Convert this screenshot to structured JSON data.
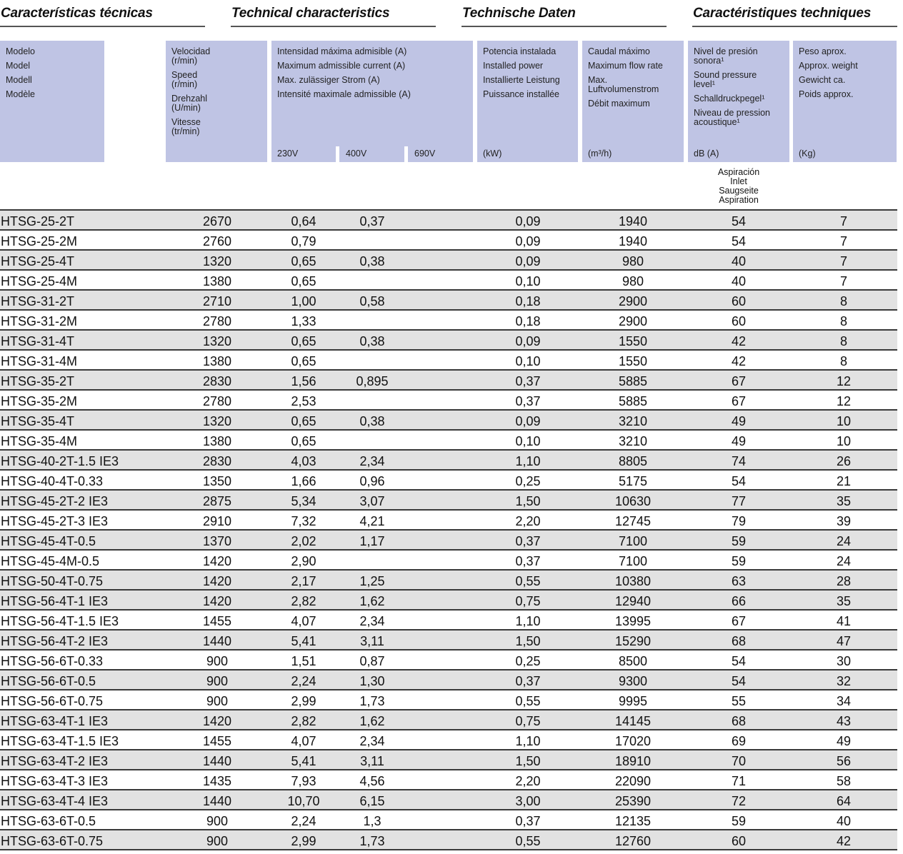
{
  "titles": [
    "Características técnicas",
    "Technical characteristics",
    "Technische Daten",
    "Caractéristiques techniques"
  ],
  "header": {
    "model": [
      "Modelo",
      "Model",
      "Modell",
      "Modèle"
    ],
    "speed": [
      "Velocidad (r/min)",
      "Speed (r/min)",
      "Drehzahl (U/min)",
      "Vitesse (tr/min)"
    ],
    "current": [
      "Intensidad máxima admisible (A)",
      "Maximum admissible current (A)",
      "Max. zulässiger Strom (A)",
      "Intensité maximale admissible (A)"
    ],
    "voltages": [
      "230V",
      "400V",
      "690V"
    ],
    "power": [
      "Potencia instalada",
      "Installed power",
      "Installierte Leistung",
      "Puissance installée"
    ],
    "power_unit": "(kW)",
    "flow": [
      "Caudal máximo",
      "Maximum flow rate",
      "Max. Luftvolumenstrom",
      "Débit maximum"
    ],
    "flow_unit": "(m³/h)",
    "sound": [
      "Nivel de presión sonora¹",
      "Sound pressure level¹",
      "Schalldruckpegel¹",
      "Niveau de pression acoustique¹"
    ],
    "sound_unit": "dB (A)",
    "weight": [
      "Peso aprox.",
      "Approx. weight",
      "Gewicht ca.",
      "Poids approx."
    ],
    "weight_unit": "(Kg)",
    "inlet": [
      "Aspiración",
      "Inlet",
      "Saugseite",
      "Aspiration"
    ]
  },
  "rows": [
    [
      "HTSG-25-2T",
      "2670",
      "0,64",
      "0,37",
      "0,09",
      "1940",
      "54",
      "7"
    ],
    [
      "HTSG-25-2M",
      "2760",
      "0,79",
      "",
      "0,09",
      "1940",
      "54",
      "7"
    ],
    [
      "HTSG-25-4T",
      "1320",
      "0,65",
      "0,38",
      "0,09",
      "980",
      "40",
      "7"
    ],
    [
      "HTSG-25-4M",
      "1380",
      "0,65",
      "",
      "0,10",
      "980",
      "40",
      "7"
    ],
    [
      "HTSG-31-2T",
      "2710",
      "1,00",
      "0,58",
      "0,18",
      "2900",
      "60",
      "8"
    ],
    [
      "HTSG-31-2M",
      "2780",
      "1,33",
      "",
      "0,18",
      "2900",
      "60",
      "8"
    ],
    [
      "HTSG-31-4T",
      "1320",
      "0,65",
      "0,38",
      "0,09",
      "1550",
      "42",
      "8"
    ],
    [
      "HTSG-31-4M",
      "1380",
      "0,65",
      "",
      "0,10",
      "1550",
      "42",
      "8"
    ],
    [
      "HTSG-35-2T",
      "2830",
      "1,56",
      "0,895",
      "0,37",
      "5885",
      "67",
      "12"
    ],
    [
      "HTSG-35-2M",
      "2780",
      "2,53",
      "",
      "0,37",
      "5885",
      "67",
      "12"
    ],
    [
      "HTSG-35-4T",
      "1320",
      "0,65",
      "0,38",
      "0,09",
      "3210",
      "49",
      "10"
    ],
    [
      "HTSG-35-4M",
      "1380",
      "0,65",
      "",
      "0,10",
      "3210",
      "49",
      "10"
    ],
    [
      "HTSG-40-2T-1.5 IE3",
      "2830",
      "4,03",
      "2,34",
      "1,10",
      "8805",
      "74",
      "26"
    ],
    [
      "HTSG-40-4T-0.33",
      "1350",
      "1,66",
      "0,96",
      "0,25",
      "5175",
      "54",
      "21"
    ],
    [
      "HTSG-45-2T-2 IE3",
      "2875",
      "5,34",
      "3,07",
      "1,50",
      "10630",
      "77",
      "35"
    ],
    [
      "HTSG-45-2T-3 IE3",
      "2910",
      "7,32",
      "4,21",
      "2,20",
      "12745",
      "79",
      "39"
    ],
    [
      "HTSG-45-4T-0.5",
      "1370",
      "2,02",
      "1,17",
      "0,37",
      "7100",
      "59",
      "24"
    ],
    [
      "HTSG-45-4M-0.5",
      "1420",
      "2,90",
      "",
      "0,37",
      "7100",
      "59",
      "24"
    ],
    [
      "HTSG-50-4T-0.75",
      "1420",
      "2,17",
      "1,25",
      "0,55",
      "10380",
      "63",
      "28"
    ],
    [
      "HTSG-56-4T-1 IE3",
      "1420",
      "2,82",
      "1,62",
      "0,75",
      "12940",
      "66",
      "35"
    ],
    [
      "HTSG-56-4T-1.5 IE3",
      "1455",
      "4,07",
      "2,34",
      "1,10",
      "13995",
      "67",
      "41"
    ],
    [
      "HTSG-56-4T-2 IE3",
      "1440",
      "5,41",
      "3,11",
      "1,50",
      "15290",
      "68",
      "47"
    ],
    [
      "HTSG-56-6T-0.33",
      "900",
      "1,51",
      "0,87",
      "0,25",
      "8500",
      "54",
      "30"
    ],
    [
      "HTSG-56-6T-0.5",
      "900",
      "2,24",
      "1,30",
      "0,37",
      "9300",
      "54",
      "32"
    ],
    [
      "HTSG-56-6T-0.75",
      "900",
      "2,99",
      "1,73",
      "0,55",
      "9995",
      "55",
      "34"
    ],
    [
      "HTSG-63-4T-1 IE3",
      "1420",
      "2,82",
      "1,62",
      "0,75",
      "14145",
      "68",
      "43"
    ],
    [
      "HTSG-63-4T-1.5 IE3",
      "1455",
      "4,07",
      "2,34",
      "1,10",
      "17020",
      "69",
      "49"
    ],
    [
      "HTSG-63-4T-2 IE3",
      "1440",
      "5,41",
      "3,11",
      "1,50",
      "18910",
      "70",
      "56"
    ],
    [
      "HTSG-63-4T-3 IE3",
      "1435",
      "7,93",
      "4,56",
      "2,20",
      "22090",
      "71",
      "58"
    ],
    [
      "HTSG-63-4T-4 IE3",
      "1440",
      "10,70",
      "6,15",
      "3,00",
      "25390",
      "72",
      "64"
    ],
    [
      "HTSG-63-6T-0.5",
      "900",
      "2,24",
      "1,3",
      "0,37",
      "12135",
      "59",
      "40"
    ],
    [
      "HTSG-63-6T-0.75",
      "900",
      "2,99",
      "1,73",
      "0,55",
      "12760",
      "60",
      "42"
    ]
  ]
}
